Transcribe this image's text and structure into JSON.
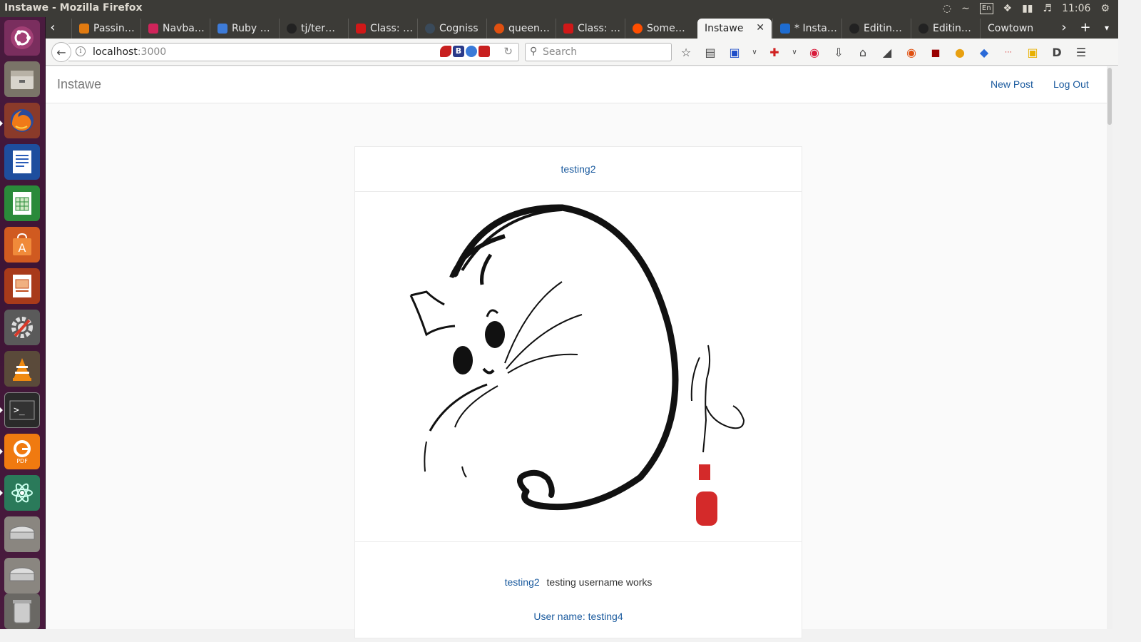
{
  "window": {
    "title": "Instawe - Mozilla Firefox"
  },
  "system_tray": {
    "keyboard": "En",
    "time": "11:06"
  },
  "launcher": {
    "items": [
      "ubuntu-dash",
      "files",
      "firefox",
      "writer",
      "calc",
      "software-center",
      "impress",
      "system-settings",
      "vlc",
      "terminal",
      "foxit-pdf",
      "atom",
      "drive-1",
      "drive-2",
      "trash"
    ]
  },
  "tabs": [
    {
      "label": "Passin…",
      "color": "#e07a10"
    },
    {
      "label": "Navba…",
      "color": "#d0245a"
    },
    {
      "label": "Ruby …",
      "color": "#3d7bd8"
    },
    {
      "label": "tj/ter…",
      "color": "#222222"
    },
    {
      "label": "Class: …",
      "color": "#d01818"
    },
    {
      "label": "Cogniss",
      "color": "#3a4a5a"
    },
    {
      "label": "queen…",
      "color": "#e05010"
    },
    {
      "label": "Class: …",
      "color": "#d01818"
    },
    {
      "label": "Some…",
      "color": "#ff4e00"
    },
    {
      "label": "Instawe",
      "color": "#ffffff",
      "active": true
    },
    {
      "label": "* Insta…",
      "color": "#1e6cd0"
    },
    {
      "label": "Editin…",
      "color": "#222222"
    },
    {
      "label": "Editin…",
      "color": "#222222"
    },
    {
      "label": "Cowtown",
      "color": "#ffffff"
    }
  ],
  "address": {
    "host": "localhost",
    "port": ":3000"
  },
  "search": {
    "placeholder": "Search"
  },
  "app": {
    "brand": "Instawe",
    "nav": {
      "new_post": "New Post",
      "log_out": "Log Out"
    }
  },
  "post": {
    "author": "testing2",
    "caption_user": "testing2",
    "caption_text": "testing username works",
    "user_name_line": "User name: testing4"
  },
  "colors": {
    "link": "#1a5a9e",
    "brand": "#777777",
    "launcher": "#4a1b3f"
  }
}
